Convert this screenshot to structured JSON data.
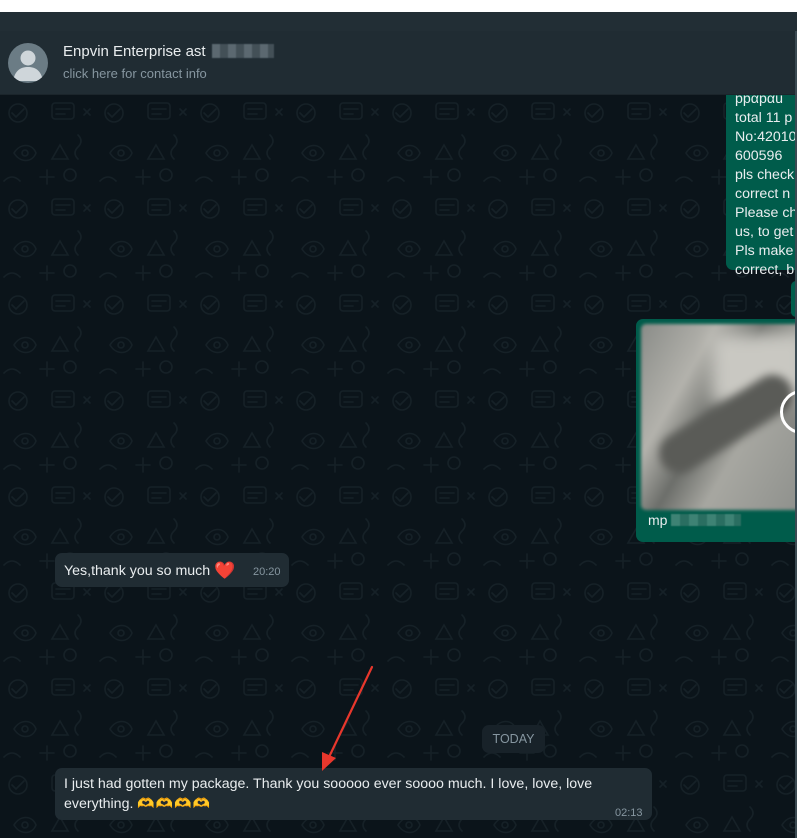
{
  "header": {
    "contact_name": "Enpvin Enterprise  ast",
    "contact_subtitle": "click here for contact info",
    "avatar_icon": "default-user-avatar-icon"
  },
  "messages": {
    "outgoing_text_lines": [
      "ppαpαu",
      "total 11 p",
      "No:42010",
      "600596",
      " pls check",
      "correct n",
      "Please ch",
      "us, to get",
      "Pls make",
      "correct, b"
    ],
    "media_caption": "mp",
    "incoming_1": {
      "text": "Yes,thank you so much",
      "emoji": "❤️",
      "time": "20:20"
    },
    "date_separator": "TODAY",
    "incoming_2": {
      "text_line1": "I just had gotten my package.  Thank you sooooo ever soooo much. I love, love, love",
      "text_line2": "everything.",
      "emoji": "🫶🫶🫶🫶",
      "time": "02:13"
    }
  },
  "annotation": {
    "arrow_color": "#e8372c",
    "arrow_icon": "red-arrow-annotation"
  },
  "colors": {
    "chat_bg": "#0b141a",
    "header_bg": "#202c33",
    "outgoing_bubble": "#005c4b",
    "incoming_bubble": "#202c33",
    "meta_text": "#8696a0"
  }
}
